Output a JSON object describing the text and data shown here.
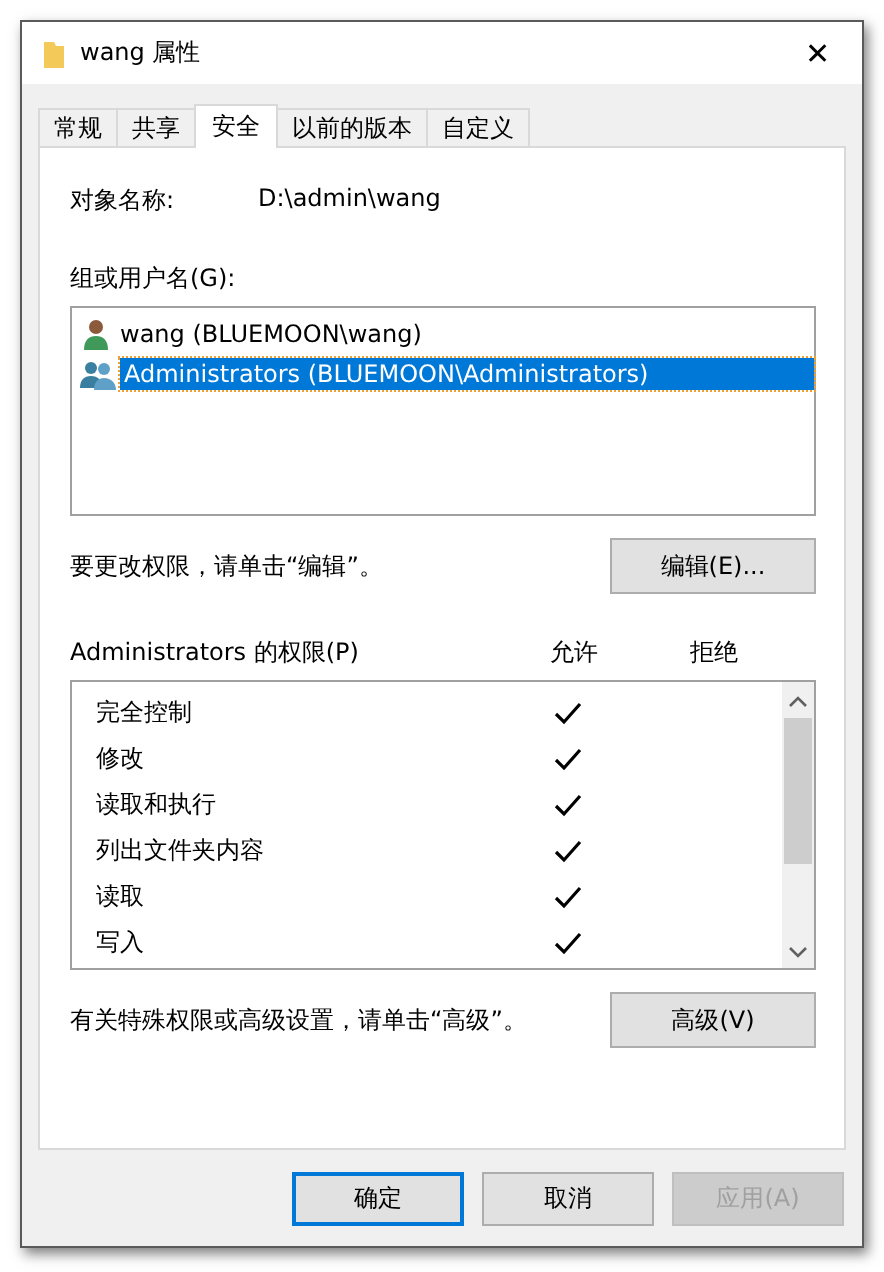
{
  "window": {
    "title": "wang 属性",
    "close": "✕"
  },
  "tabs": [
    {
      "label": "常规",
      "selected": false
    },
    {
      "label": "共享",
      "selected": false
    },
    {
      "label": "安全",
      "selected": true
    },
    {
      "label": "以前的版本",
      "selected": false
    },
    {
      "label": "自定义",
      "selected": false
    }
  ],
  "object_name": {
    "label": "对象名称:",
    "value": "D:\\admin\\wang"
  },
  "users": {
    "label": "组或用户名(G):",
    "items": [
      {
        "name": "wang (BLUEMOON\\wang)",
        "kind": "user",
        "selected": false
      },
      {
        "name": "Administrators (BLUEMOON\\Administrators)",
        "kind": "group",
        "selected": true
      }
    ]
  },
  "edit_hint": "要更改权限，请单击“编辑”。",
  "edit_button": "编辑(E)...",
  "permissions": {
    "label": "Administrators 的权限(P)",
    "allow_header": "允许",
    "deny_header": "拒绝",
    "rows": [
      {
        "name": "完全控制",
        "allow": true,
        "deny": false
      },
      {
        "name": "修改",
        "allow": true,
        "deny": false
      },
      {
        "name": "读取和执行",
        "allow": true,
        "deny": false
      },
      {
        "name": "列出文件夹内容",
        "allow": true,
        "deny": false
      },
      {
        "name": "读取",
        "allow": true,
        "deny": false
      },
      {
        "name": "写入",
        "allow": true,
        "deny": false
      }
    ]
  },
  "advanced_hint": "有关特殊权限或高级设置，请单击“高级”。",
  "advanced_button": "高级(V)",
  "buttons": [
    {
      "label": "确定",
      "kind": "default",
      "disabled": false
    },
    {
      "label": "取消",
      "kind": "normal",
      "disabled": false
    },
    {
      "label": "应用(A)",
      "kind": "normal",
      "disabled": true
    }
  ]
}
